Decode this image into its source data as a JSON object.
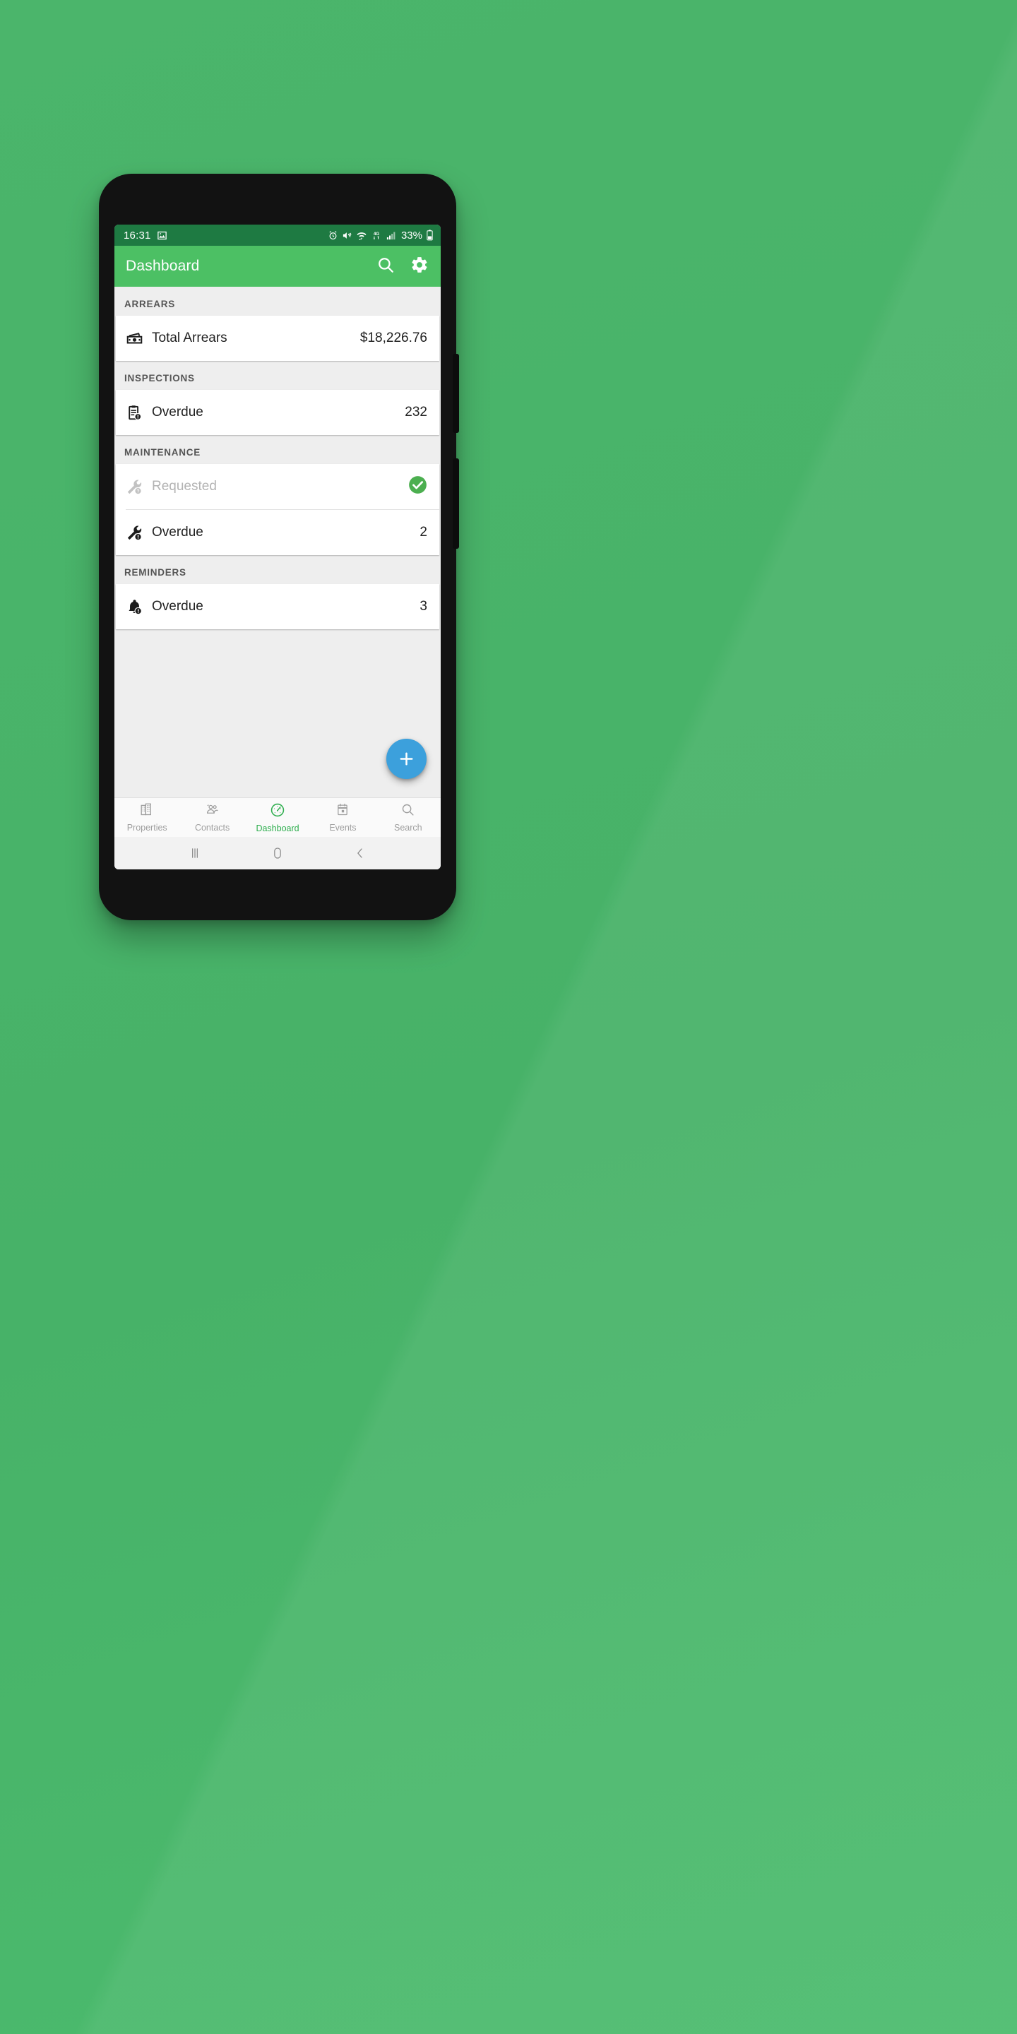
{
  "wallpaper": {
    "color": "#4BB56B"
  },
  "status_bar": {
    "time": "16:31",
    "battery_percent": "33%",
    "icons": [
      "image-icon",
      "alarm-icon",
      "mute-vibrate-icon",
      "wifi-icon",
      "network-4g-icon",
      "signal-bars-icon",
      "battery-icon"
    ],
    "background": "#1E7A42"
  },
  "app_bar": {
    "title": "Dashboard",
    "background": "#4CC064",
    "actions": [
      {
        "name": "search-icon",
        "label": "Search"
      },
      {
        "name": "gear-icon",
        "label": "Settings"
      }
    ]
  },
  "sections": [
    {
      "header": "ARREARS",
      "rows": [
        {
          "icon": "cash-icon",
          "label": "Total Arrears",
          "value": "$18,226.76",
          "muted": false,
          "status": null
        }
      ]
    },
    {
      "header": "INSPECTIONS",
      "rows": [
        {
          "icon": "clipboard-alert-icon",
          "label": "Overdue",
          "value": "232",
          "muted": false,
          "status": null
        }
      ]
    },
    {
      "header": "MAINTENANCE",
      "rows": [
        {
          "icon": "wrench-question-icon",
          "label": "Requested",
          "value": "",
          "muted": true,
          "status": "check"
        },
        {
          "icon": "wrench-alert-icon",
          "label": "Overdue",
          "value": "2",
          "muted": false,
          "status": null
        }
      ]
    },
    {
      "header": "REMINDERS",
      "rows": [
        {
          "icon": "bell-alert-icon",
          "label": "Overdue",
          "value": "3",
          "muted": false,
          "status": null
        }
      ]
    }
  ],
  "fab": {
    "label": "+",
    "name": "add-button",
    "color": "#3CA0DC"
  },
  "bottom_nav": {
    "active_color": "#2EAE4E",
    "items": [
      {
        "label": "Properties",
        "icon": "buildings-icon",
        "active": false
      },
      {
        "label": "Contacts",
        "icon": "people-icon",
        "active": false
      },
      {
        "label": "Dashboard",
        "icon": "gauge-icon",
        "active": true
      },
      {
        "label": "Events",
        "icon": "calendar-icon",
        "active": false
      },
      {
        "label": "Search",
        "icon": "magnifier-icon",
        "active": false
      }
    ]
  },
  "android_nav": {
    "items": [
      {
        "name": "recents-button",
        "glyph": "recents-icon"
      },
      {
        "name": "home-button",
        "glyph": "home-icon"
      },
      {
        "name": "back-button",
        "glyph": "back-icon"
      }
    ]
  }
}
